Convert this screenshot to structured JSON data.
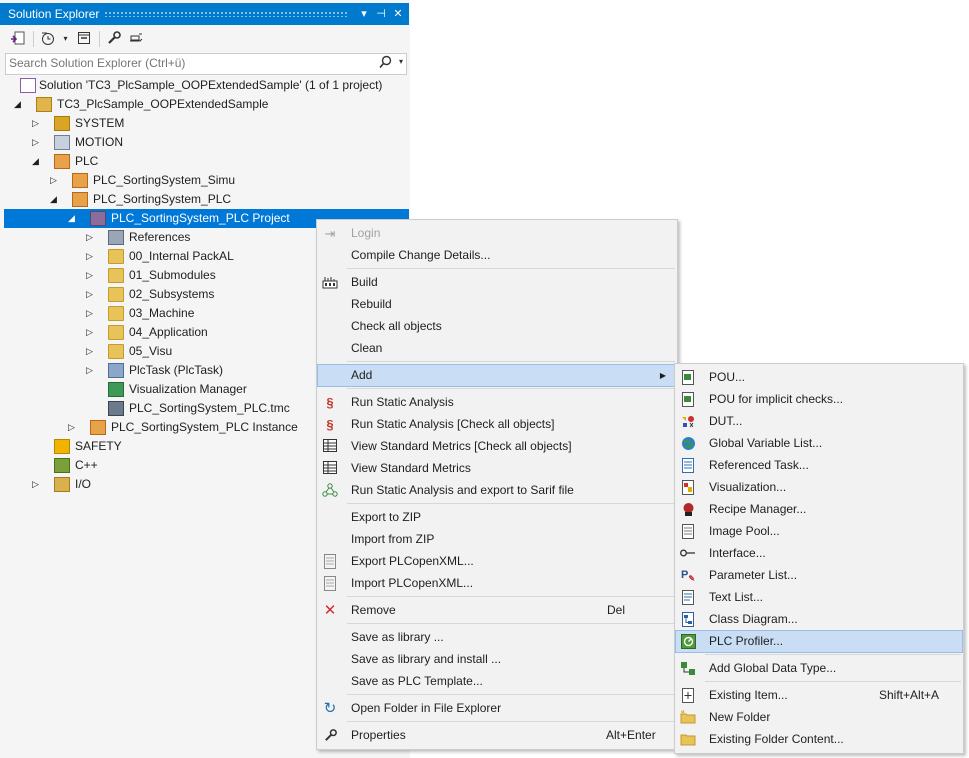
{
  "explorer": {
    "title": "Solution Explorer",
    "title_buttons": [
      "▾",
      "⊣",
      "✕"
    ],
    "search_placeholder": "Search Solution Explorer (Ctrl+ü)",
    "tree": [
      {
        "label": "Solution 'TC3_PlcSample_OOPExtendedSample' (1 of 1 project)",
        "icon": "solution-icon",
        "arrow": ""
      },
      {
        "label": "TC3_PlcSample_OOPExtendedSample",
        "icon": "twincat-project-icon",
        "arrow": "◢"
      },
      {
        "label": "SYSTEM",
        "icon": "system-icon",
        "arrow": "▷"
      },
      {
        "label": "MOTION",
        "icon": "motion-icon",
        "arrow": "▷"
      },
      {
        "label": "PLC",
        "icon": "plc-icon",
        "arrow": "◢"
      },
      {
        "label": "PLC_SortingSystem_Simu",
        "icon": "plc-project-icon",
        "arrow": "▷"
      },
      {
        "label": "PLC_SortingSystem_PLC",
        "icon": "plc-project-icon",
        "arrow": "◢"
      },
      {
        "label": "PLC_SortingSystem_PLC Project",
        "icon": "plc-subproject-icon",
        "arrow": "◢"
      },
      {
        "label": "References",
        "icon": "references-icon",
        "arrow": "▷"
      },
      {
        "label": "00_Internal PackAL",
        "icon": "folder-icon",
        "arrow": "▷"
      },
      {
        "label": "01_Submodules",
        "icon": "folder-icon",
        "arrow": "▷"
      },
      {
        "label": "02_Subsystems",
        "icon": "folder-icon",
        "arrow": "▷"
      },
      {
        "label": "03_Machine",
        "icon": "folder-icon",
        "arrow": "▷"
      },
      {
        "label": "04_Application",
        "icon": "folder-icon",
        "arrow": "▷"
      },
      {
        "label": "05_Visu",
        "icon": "folder-icon",
        "arrow": "▷"
      },
      {
        "label": "PlcTask (PlcTask)",
        "icon": "task-icon",
        "arrow": "▷"
      },
      {
        "label": "Visualization Manager",
        "icon": "visualization-manager-icon",
        "arrow": ""
      },
      {
        "label": "PLC_SortingSystem_PLC.tmc",
        "icon": "tmc-file-icon",
        "arrow": ""
      },
      {
        "label": "PLC_SortingSystem_PLC Instance",
        "icon": "plc-instance-icon",
        "arrow": "▷"
      },
      {
        "label": "SAFETY",
        "icon": "safety-icon",
        "arrow": ""
      },
      {
        "label": "C++",
        "icon": "cpp-icon",
        "arrow": ""
      },
      {
        "label": "I/O",
        "icon": "io-icon",
        "arrow": "▷"
      }
    ]
  },
  "context_menu": {
    "items": [
      {
        "label": "Login",
        "icon": "login-icon",
        "key": "",
        "disabled": true
      },
      {
        "label": "Compile Change Details...",
        "icon": "",
        "key": ""
      },
      {
        "label": "Build",
        "icon": "build-icon",
        "key": ""
      },
      {
        "label": "Rebuild",
        "icon": "",
        "key": ""
      },
      {
        "label": "Check all objects",
        "icon": "",
        "key": ""
      },
      {
        "label": "Clean",
        "icon": "",
        "key": ""
      },
      {
        "label": "Add",
        "icon": "",
        "key": "",
        "submenu": true
      },
      {
        "label": "Run Static Analysis",
        "icon": "static-analysis-icon",
        "key": ""
      },
      {
        "label": "Run Static Analysis [Check all objects]",
        "icon": "static-analysis-icon",
        "key": ""
      },
      {
        "label": "View Standard Metrics [Check all objects]",
        "icon": "metrics-icon",
        "key": ""
      },
      {
        "label": "View Standard Metrics",
        "icon": "metrics-icon",
        "key": ""
      },
      {
        "label": "Run Static Analysis and export to Sarif file",
        "icon": "sarif-export-icon",
        "key": ""
      },
      {
        "label": "Export to ZIP",
        "icon": "",
        "key": ""
      },
      {
        "label": "Import from ZIP",
        "icon": "",
        "key": ""
      },
      {
        "label": "Export PLCopenXML...",
        "icon": "export-xml-icon",
        "key": ""
      },
      {
        "label": "Import PLCopenXML...",
        "icon": "import-xml-icon",
        "key": ""
      },
      {
        "label": "Remove",
        "icon": "remove-icon",
        "key": "Del"
      },
      {
        "label": "Save as library ...",
        "icon": "",
        "key": ""
      },
      {
        "label": "Save as library and install ...",
        "icon": "",
        "key": ""
      },
      {
        "label": "Save as PLC Template...",
        "icon": "",
        "key": ""
      },
      {
        "label": "Open Folder in File Explorer",
        "icon": "open-folder-icon",
        "key": ""
      },
      {
        "label": "Properties",
        "icon": "properties-icon",
        "key": "Alt+Enter"
      }
    ]
  },
  "add_submenu": {
    "items": [
      {
        "label": "POU...",
        "icon": "pou-icon",
        "key": ""
      },
      {
        "label": "POU for implicit checks...",
        "icon": "pou-checks-icon",
        "key": ""
      },
      {
        "label": "DUT...",
        "icon": "dut-icon",
        "key": ""
      },
      {
        "label": "Global Variable List...",
        "icon": "global-variable-list-icon",
        "key": ""
      },
      {
        "label": "Referenced Task...",
        "icon": "referenced-task-icon",
        "key": ""
      },
      {
        "label": "Visualization...",
        "icon": "visualization-icon",
        "key": ""
      },
      {
        "label": "Recipe Manager...",
        "icon": "recipe-manager-icon",
        "key": ""
      },
      {
        "label": "Image Pool...",
        "icon": "image-pool-icon",
        "key": ""
      },
      {
        "label": "Interface...",
        "icon": "interface-icon",
        "key": ""
      },
      {
        "label": "Parameter List...",
        "icon": "parameter-list-icon",
        "key": ""
      },
      {
        "label": "Text List...",
        "icon": "text-list-icon",
        "key": ""
      },
      {
        "label": "Class Diagram...",
        "icon": "class-diagram-icon",
        "key": ""
      },
      {
        "label": "PLC Profiler...",
        "icon": "plc-profiler-icon",
        "key": "",
        "highlighted": true
      },
      {
        "label": "Add Global Data Type...",
        "icon": "global-data-type-icon",
        "key": ""
      },
      {
        "label": "Existing Item...",
        "icon": "existing-item-icon",
        "key": "Shift+Alt+A"
      },
      {
        "label": "New Folder",
        "icon": "new-folder-icon",
        "key": ""
      },
      {
        "label": "Existing Folder Content...",
        "icon": "folder-content-icon",
        "key": ""
      }
    ]
  },
  "colors": {
    "accent": "#007acc",
    "selection": "#0078d7",
    "menu_highlight": "#c9def5"
  }
}
